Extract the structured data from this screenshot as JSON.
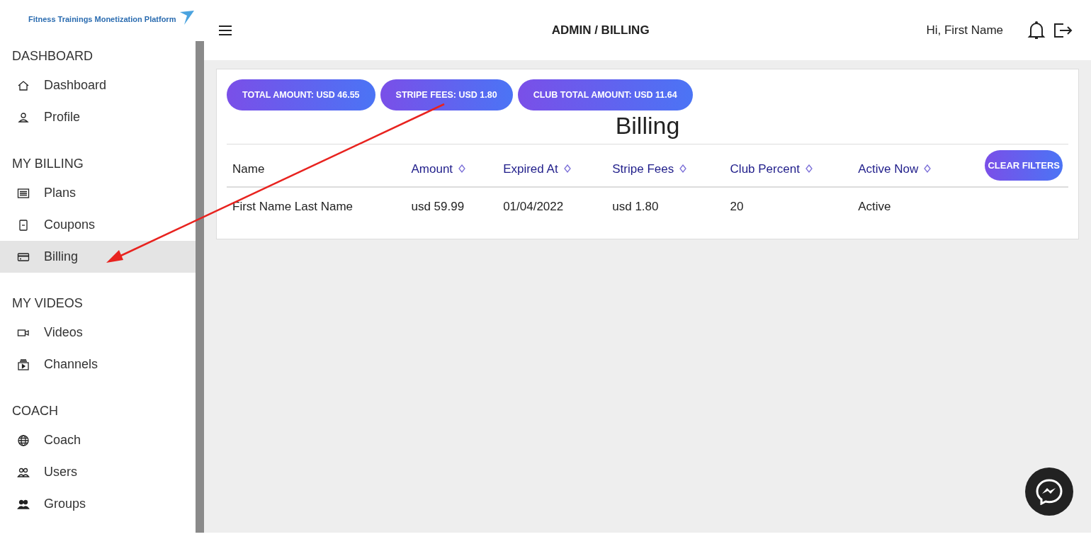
{
  "logo": {
    "text": "Fitness Trainings Monetization Platform"
  },
  "sidebar": {
    "sections": [
      {
        "title": "DASHBOARD",
        "items": [
          {
            "label": "Dashboard",
            "kind": "home",
            "selected": false
          },
          {
            "label": "Profile",
            "kind": "user",
            "selected": false
          }
        ]
      },
      {
        "title": "MY BILLING",
        "items": [
          {
            "label": "Plans",
            "kind": "list",
            "selected": false
          },
          {
            "label": "Coupons",
            "kind": "coupon",
            "selected": false
          },
          {
            "label": "Billing",
            "kind": "card",
            "selected": true
          }
        ]
      },
      {
        "title": "MY VIDEOS",
        "items": [
          {
            "label": "Videos",
            "kind": "video",
            "selected": false
          },
          {
            "label": "Channels",
            "kind": "channel",
            "selected": false
          }
        ]
      },
      {
        "title": "COACH",
        "items": [
          {
            "label": "Coach",
            "kind": "globe",
            "selected": false
          },
          {
            "label": "Users",
            "kind": "users",
            "selected": false
          },
          {
            "label": "Groups",
            "kind": "group",
            "selected": false
          }
        ]
      }
    ]
  },
  "header": {
    "breadcrumb": "ADMIN / BILLING",
    "greeting": "Hi, First Name"
  },
  "summary_pills": [
    "TOTAL AMOUNT: USD 46.55",
    "STRIPE FEES: USD 1.80",
    "CLUB TOTAL AMOUNT: USD 11.64"
  ],
  "page_title": "Billing",
  "table": {
    "columns": [
      {
        "label": "Name",
        "sortable": false
      },
      {
        "label": "Amount",
        "sortable": true
      },
      {
        "label": "Expired At",
        "sortable": true
      },
      {
        "label": "Stripe Fees",
        "sortable": true
      },
      {
        "label": "Club Percent",
        "sortable": true
      },
      {
        "label": "Active Now",
        "sortable": true
      }
    ],
    "clear_button": "CLEAR FILTERS",
    "rows": [
      [
        "First Name Last Name",
        "usd 59.99",
        "01/04/2022",
        "usd 1.80",
        "20",
        "Active"
      ]
    ]
  },
  "annotation": {
    "kind": "arrow"
  }
}
